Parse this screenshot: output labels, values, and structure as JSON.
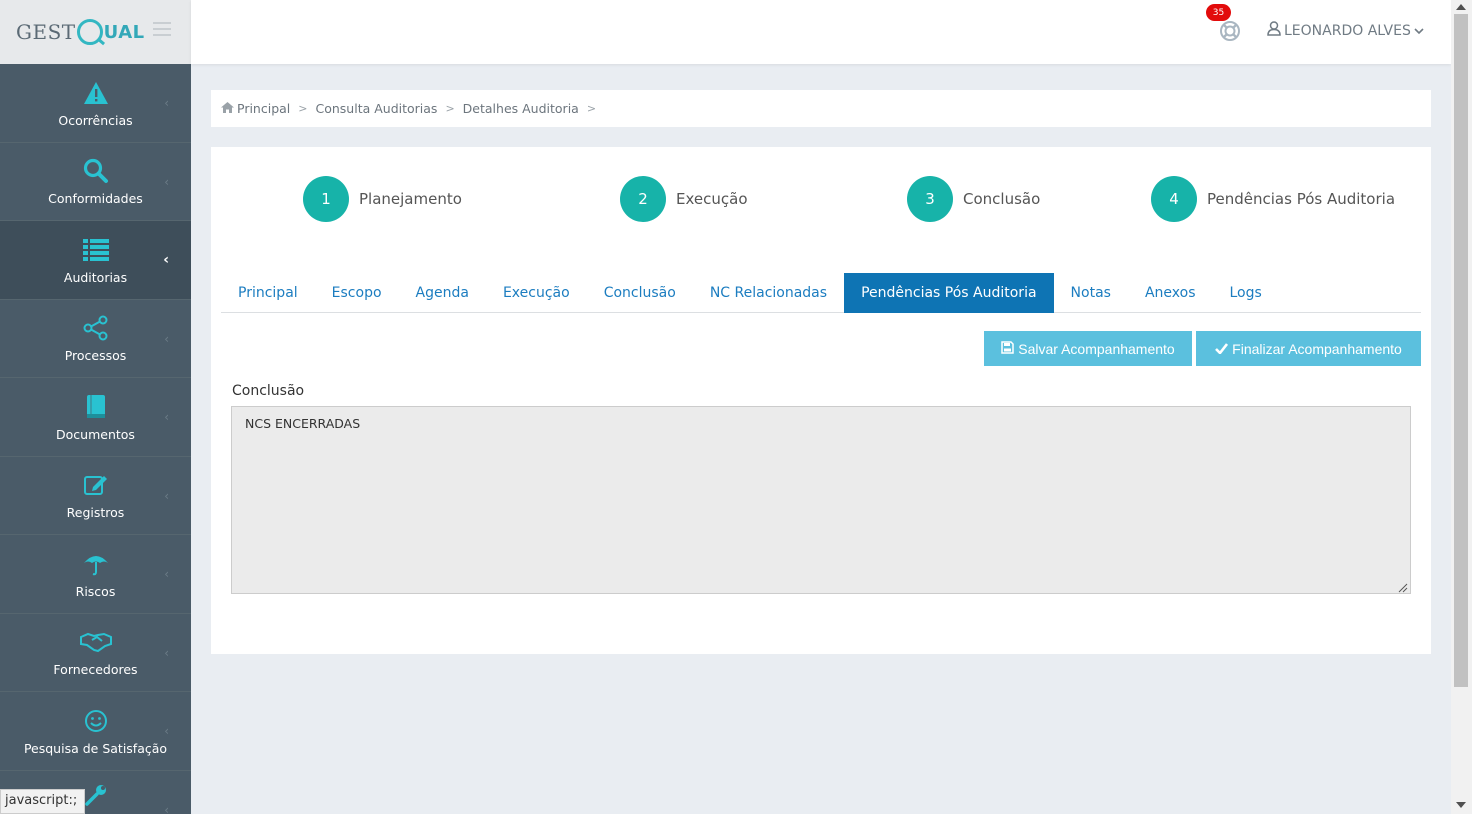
{
  "brand": {
    "text_a": "GEST",
    "text_b": "UAL"
  },
  "sidebar": {
    "items": [
      {
        "label": "Ocorrências",
        "icon": "warning-icon"
      },
      {
        "label": "Conformidades",
        "icon": "search-icon"
      },
      {
        "label": "Auditorias",
        "icon": "list-icon",
        "active": true
      },
      {
        "label": "Processos",
        "icon": "share-icon"
      },
      {
        "label": "Documentos",
        "icon": "book-icon"
      },
      {
        "label": "Registros",
        "icon": "edit-icon"
      },
      {
        "label": "Riscos",
        "icon": "umbrella-icon"
      },
      {
        "label": "Fornecedores",
        "icon": "handshake-icon"
      },
      {
        "label": "Pesquisa de Satisfação",
        "icon": "smile-icon"
      },
      {
        "label": "",
        "icon": "wrench-icon"
      }
    ]
  },
  "topbar": {
    "notification_count": "35",
    "user_name": "LEONARDO ALVES"
  },
  "breadcrumb": [
    "Principal",
    "Consulta Auditorias",
    "Detalhes Auditoria"
  ],
  "steps": [
    {
      "number": "1",
      "label": "Planejamento"
    },
    {
      "number": "2",
      "label": "Execução"
    },
    {
      "number": "3",
      "label": "Conclusão"
    },
    {
      "number": "4",
      "label": "Pendências Pós Auditoria"
    }
  ],
  "tabs": [
    {
      "label": "Principal"
    },
    {
      "label": "Escopo"
    },
    {
      "label": "Agenda"
    },
    {
      "label": "Execução"
    },
    {
      "label": "Conclusão"
    },
    {
      "label": "NC Relacionadas"
    },
    {
      "label": "Pendências Pós Auditoria",
      "active": true
    },
    {
      "label": "Notas"
    },
    {
      "label": "Anexos"
    },
    {
      "label": "Logs"
    }
  ],
  "actions": {
    "save_label": "Salvar Acompanhamento",
    "finish_label": "Finalizar Acompanhamento"
  },
  "form": {
    "conclusion_label": "Conclusão",
    "conclusion_value": "NCS ENCERRADAS"
  },
  "status_bar": "javascript:;",
  "colors": {
    "sidebar": "#4a5b68",
    "step": "#17b3a9",
    "tab_active": "#0e74b4",
    "button": "#5bc0de",
    "link": "#1c7dc0",
    "badge": "#e20b0b"
  }
}
